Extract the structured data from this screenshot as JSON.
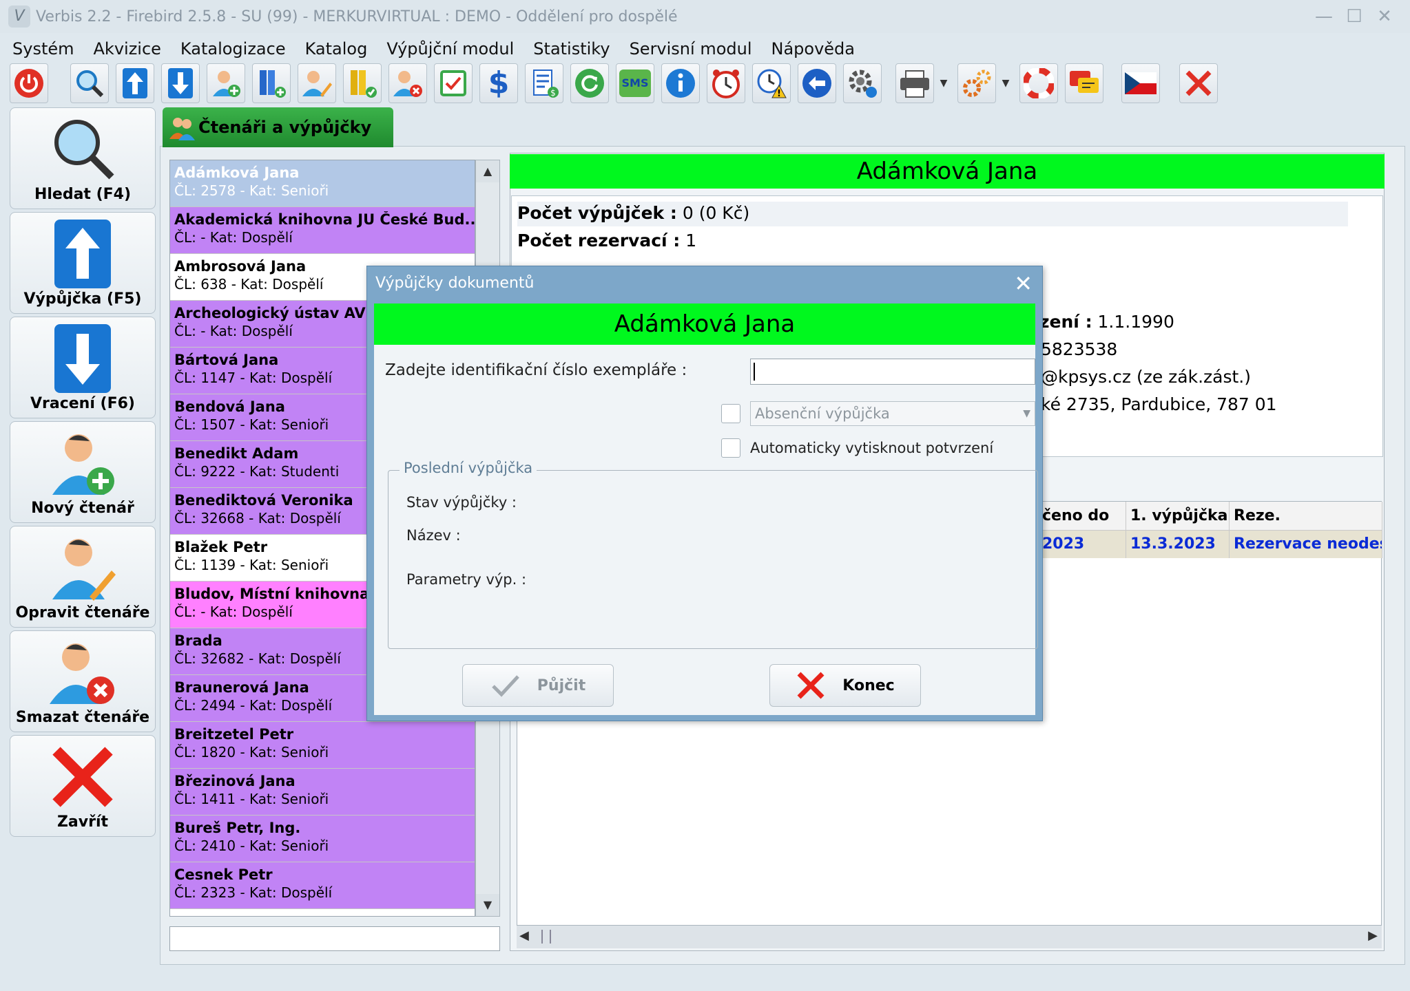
{
  "window": {
    "title": "Verbis 2.2 - Firebird 2.5.8 - SU (99) - MERKURVIRTUAL : DEMO - Oddělení pro dospělé"
  },
  "menu": [
    "Systém",
    "Akvizice",
    "Katalogizace",
    "Katalog",
    "Výpůjční modul",
    "Statistiky",
    "Servisní modul",
    "Nápověda"
  ],
  "toolbar": {
    "sms_label": "SMS",
    "icons": [
      "power-icon",
      "search-icon",
      "upload-arrow-icon",
      "download-arrow-icon",
      "add-user-icon",
      "add-items-icon",
      "edit-user-icon",
      "approved-items-icon",
      "delete-user-icon",
      "checkbox-icon",
      "dollar-icon",
      "money-list-icon",
      "refresh-icon",
      "sms-icon",
      "info-icon",
      "alarm-clock-icon",
      "clock-warning-icon",
      "back-arrow-icon",
      "settings-gear-icon",
      "printer-icon",
      "gears-icon",
      "lifebuoy-icon",
      "chat-icon",
      "czech-flag-icon",
      "close-red-icon"
    ]
  },
  "leftbuttons": {
    "search": "Hledat (F4)",
    "loan": "Výpůjčka (F5)",
    "return": "Vracení (F6)",
    "new_reader": "Nový čtenář",
    "edit_reader": "Opravit čtenáře",
    "delete_reader": "Smazat čtenáře",
    "close": "Zavřít"
  },
  "tab": {
    "label": "Čtenáři a výpůjčky"
  },
  "readers": [
    {
      "name": "Adámková Jana",
      "sub": "ČL: 2578 - Kat: Senioři",
      "color": "#b2c8e6",
      "text": "#ffffff"
    },
    {
      "name": "Akademická knihovna JU České Bud...",
      "sub": "ČL:  - Kat: Dospělí",
      "color": "#c183f5",
      "text": "#000000"
    },
    {
      "name": "Ambrosová Jana",
      "sub": "ČL: 638 - Kat: Dospělí",
      "color": "#ffffff",
      "text": "#000000"
    },
    {
      "name": "Archeologický ústav AV ČR",
      "sub": "ČL:  - Kat: Dospělí",
      "color": "#c183f5",
      "text": "#000000"
    },
    {
      "name": "Bártová Jana",
      "sub": "ČL: 1147 - Kat: Dospělí",
      "color": "#c183f5",
      "text": "#000000"
    },
    {
      "name": "Bendová Jana",
      "sub": "ČL: 1507 - Kat: Senioři",
      "color": "#c183f5",
      "text": "#000000"
    },
    {
      "name": "Benedikt Adam",
      "sub": "ČL: 9222 - Kat: Studenti",
      "color": "#c183f5",
      "text": "#000000"
    },
    {
      "name": "Benediktová Veronika",
      "sub": "ČL: 32668 - Kat: Dospělí",
      "color": "#c183f5",
      "text": "#000000"
    },
    {
      "name": "Blažek Petr",
      "sub": "ČL: 1139 - Kat: Senioři",
      "color": "#ffffff",
      "text": "#000000"
    },
    {
      "name": "Bludov, Místní knihovna E",
      "sub": "ČL:  - Kat: Dospělí",
      "color": "#ff80ff",
      "text": "#000000"
    },
    {
      "name": "Brada",
      "sub": "ČL: 32682 - Kat: Dospělí",
      "color": "#c183f5",
      "text": "#000000"
    },
    {
      "name": "Braunerová Jana",
      "sub": "ČL: 2494 - Kat: Dospělí",
      "color": "#c183f5",
      "text": "#000000"
    },
    {
      "name": "Breitzetel Petr",
      "sub": "ČL: 1820 - Kat: Senioři",
      "color": "#c183f5",
      "text": "#000000"
    },
    {
      "name": "Březinová Jana",
      "sub": "ČL: 1411 - Kat: Senioři",
      "color": "#c183f5",
      "text": "#000000"
    },
    {
      "name": "Bureš Petr, Ing.",
      "sub": "ČL: 2410 - Kat: Senioři",
      "color": "#c183f5",
      "text": "#000000"
    },
    {
      "name": "Cesnek Petr",
      "sub": "ČL: 2323 - Kat: Dospělí",
      "color": "#c183f5",
      "text": "#000000"
    }
  ],
  "detail": {
    "name": "Adámková Jana",
    "loans_label": "Počet výpůjček :",
    "loans_value": "0   (0 Kč)",
    "reservations_label": "Počet rezervací :",
    "reservations_value": "1",
    "birth_label": "zení :",
    "birth_value": "1.1.1990",
    "phone_partial": "5823538",
    "email_partial": "@kpsys.cz (ze zák.zást.)",
    "address_partial": "ké 2735, Pardubice, 787 01"
  },
  "loans_table": {
    "headers": [
      "čeno do",
      "1. výpůjčka",
      "Reze."
    ],
    "row": [
      "2023",
      "13.3.2023",
      "Rezervace neodesl"
    ]
  },
  "dialog": {
    "title": "Výpůjčky dokumentů",
    "reader_name": "Adámková Jana",
    "id_label": "Zadejte identifikační číslo exempláře :",
    "id_value": "",
    "absence_placeholder": "Absenční výpůjčka",
    "auto_print_label": "Automaticky vytisknout potvrzení",
    "group_title": "Poslední výpůjčka",
    "status_label": "Stav výpůjčky :",
    "title_label": "Název :",
    "params_label": "Parametry výp. :",
    "lend_button": "Půjčit",
    "close_button": "Konec"
  }
}
